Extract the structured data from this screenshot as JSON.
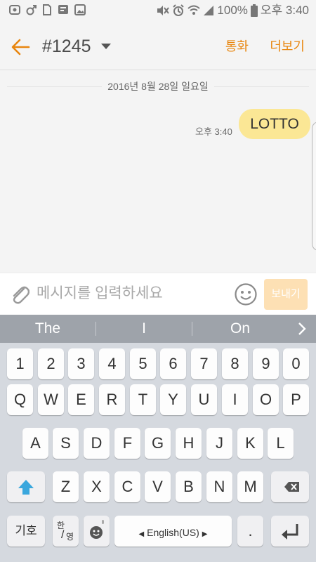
{
  "status_bar": {
    "battery_text": "100%",
    "time": "오후 3:40"
  },
  "header": {
    "back_icon": "arrow-left-icon",
    "title": "#1245",
    "call_label": "통화",
    "more_label": "더보기"
  },
  "conversation": {
    "date_divider": "2016년 8월 28일 일요일",
    "messages": [
      {
        "text": "LOTTO",
        "time": "오후 3:40",
        "direction": "outgoing"
      }
    ]
  },
  "composer": {
    "placeholder": "메시지를 입력하세요",
    "value": "",
    "send_label": "보내기"
  },
  "suggestions": [
    "The",
    "I",
    "On"
  ],
  "keyboard": {
    "row_numbers": [
      "1",
      "2",
      "3",
      "4",
      "5",
      "6",
      "7",
      "8",
      "9",
      "0"
    ],
    "row_1": [
      "Q",
      "W",
      "E",
      "R",
      "T",
      "Y",
      "U",
      "I",
      "O",
      "P"
    ],
    "row_2": [
      "A",
      "S",
      "D",
      "F",
      "G",
      "H",
      "J",
      "K",
      "L"
    ],
    "row_3": [
      "Z",
      "X",
      "C",
      "V",
      "B",
      "N",
      "M"
    ],
    "symbols_label": "기호",
    "lang_toggle_top": "한",
    "lang_toggle_bottom": "영",
    "language_label": "English(US)",
    "period_label": "."
  },
  "colors": {
    "accent": "#e8860f",
    "bubble": "#fbe795",
    "send_button": "#fde0b4",
    "shift_icon": "#3aa7dd",
    "suggestion_bar": "#9ea3aa",
    "keyboard_bg": "#d5d9df"
  }
}
